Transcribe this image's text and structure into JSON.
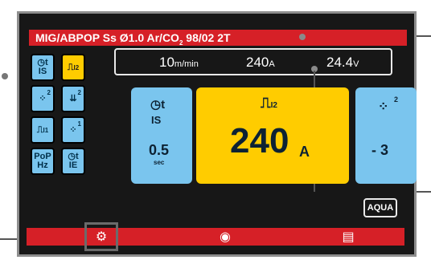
{
  "title": {
    "prefix": "MIG/ABPOP  Ss Ø1.0 Ar/CO",
    "sub": "2",
    "suffix": "  98/02 2T"
  },
  "side_icons": {
    "timer_is": {
      "line1": "t",
      "line2": "IS"
    },
    "pulse_i2": {
      "label": "I2"
    },
    "spread_2": {
      "sup": "2"
    },
    "arrows_2": {
      "sup": "2"
    },
    "step_i1": {
      "label": "I1"
    },
    "spread_1": {
      "sup": "1"
    },
    "pop_hz": {
      "line1": "PoP",
      "line2": "Hz"
    },
    "timer_ie": {
      "line1": "t",
      "line2": "IE"
    }
  },
  "readout": {
    "speed": "10",
    "speed_unit": "m/min",
    "current": "240",
    "current_unit": "A",
    "voltage": "24.4",
    "voltage_unit": "V"
  },
  "panels": {
    "left": {
      "label_t": "t",
      "label": "IS",
      "value": "0.5",
      "unit": "sec"
    },
    "center": {
      "label": "I2",
      "value": "240",
      "unit": "A"
    },
    "right": {
      "sup": "2",
      "value": "- 3"
    }
  },
  "aqua_label": "AQUA",
  "colors": {
    "red": "#d62027",
    "blue": "#7ac5ee",
    "yellow": "#ffcc00",
    "background": "#171717"
  }
}
